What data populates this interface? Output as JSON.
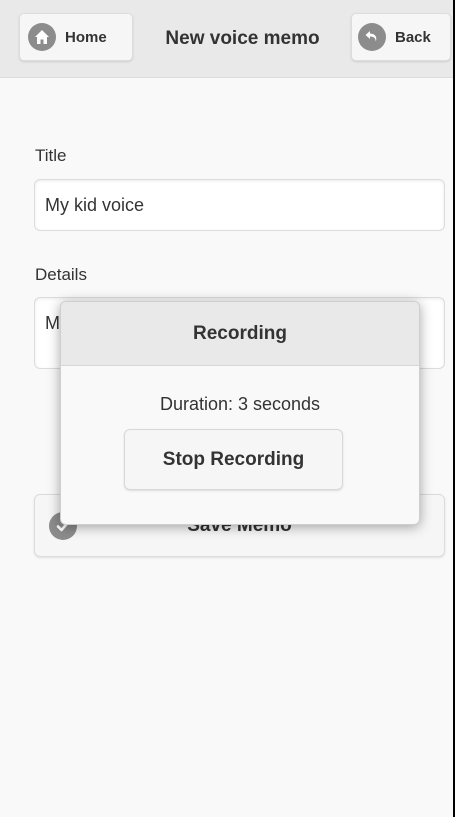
{
  "header": {
    "home_label": "Home",
    "home_icon": "home-icon",
    "title": "New voice memo",
    "back_label": "Back",
    "back_icon": "back-arrow-icon"
  },
  "form": {
    "title_label": "Title",
    "title_value": "My kid voice",
    "details_label": "Details",
    "details_value": "M",
    "save_label": "Save Memo",
    "save_icon": "check-icon"
  },
  "popup": {
    "title": "Recording",
    "duration_text": "Duration: 3 seconds",
    "stop_label": "Stop Recording"
  },
  "colors": {
    "header_bg": "#e9e9e9",
    "page_bg": "#f9f9f9",
    "icon_gray": "#8c8c8c",
    "text": "#333333"
  }
}
